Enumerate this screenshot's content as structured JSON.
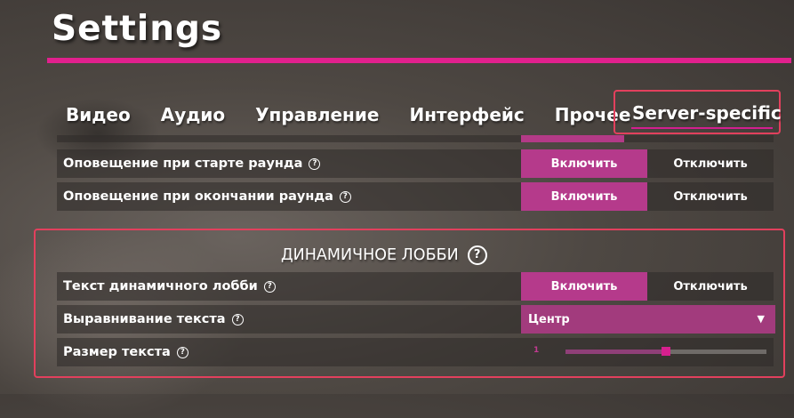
{
  "page": {
    "title": "Settings"
  },
  "tabs": [
    {
      "label": "Видео"
    },
    {
      "label": "Аудио"
    },
    {
      "label": "Управление"
    },
    {
      "label": "Интерфейс"
    },
    {
      "label": "Прочее"
    },
    {
      "label": "Server-specific",
      "active": true
    }
  ],
  "rows": {
    "round_start": {
      "label": "Оповещение при старте раунда",
      "help": "?",
      "on_label": "Включить",
      "off_label": "Отключить",
      "selected": "on"
    },
    "round_end": {
      "label": "Оповещение при окончании раунда",
      "help": "?",
      "on_label": "Включить",
      "off_label": "Отключить",
      "selected": "on"
    }
  },
  "dynamic_lobby": {
    "title": "ДИНАМИЧНОЕ ЛОББИ",
    "help": "?",
    "lobby_text": {
      "label": "Текст динамичного лобби",
      "help": "?",
      "on_label": "Включить",
      "off_label": "Отключить",
      "selected": "on"
    },
    "alignment": {
      "label": "Выравнивание текста",
      "help": "?",
      "value": "Центр",
      "arrow": "▼"
    },
    "text_size": {
      "label": "Размер текста",
      "help": "?",
      "value": "1",
      "level": 0.5
    }
  },
  "colors": {
    "accent": "#e1208d",
    "highlight_border": "#e2405d",
    "button_on": "#b53a8b"
  }
}
